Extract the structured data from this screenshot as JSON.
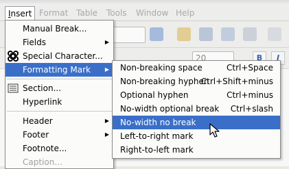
{
  "menubar": {
    "items": [
      {
        "label": "Insert",
        "accel": "I",
        "rest": "nsert"
      },
      {
        "label": "Format"
      },
      {
        "label": "Table"
      },
      {
        "label": "Tools"
      },
      {
        "label": "Window"
      },
      {
        "label": "Help"
      }
    ]
  },
  "format_bar": {
    "font_size": "20"
  },
  "insert_menu": {
    "items": [
      {
        "label": "Manual Break...",
        "a": "",
        "u": "",
        "b": "Manual ",
        "u2": "B",
        "c": "reak..."
      },
      {
        "label": "Fields"
      },
      {
        "label": "Special Character..."
      },
      {
        "label": "Formatting Mark"
      },
      {
        "label": "Section..."
      },
      {
        "label": "Hyperlink"
      },
      {
        "label": "Header"
      },
      {
        "label": "Footer"
      },
      {
        "label": "Footnote..."
      },
      {
        "label": "Caption..."
      }
    ]
  },
  "formatting_submenu": {
    "items": [
      {
        "label": "Non-breaking space",
        "shortcut": "Ctrl+Space"
      },
      {
        "label": "Non-breaking hyphen",
        "shortcut": "Ctrl+Shift+minus"
      },
      {
        "label": "Optional hyphen",
        "shortcut": "Ctrl+minus"
      },
      {
        "label": "No-width optional break",
        "shortcut": "Ctrl+slash"
      },
      {
        "label": "No-width no break",
        "shortcut": ""
      },
      {
        "label": "Left-to-right mark",
        "shortcut": ""
      },
      {
        "label": "Right-to-left mark",
        "shortcut": ""
      }
    ]
  },
  "colors": {
    "highlight": "#3a6fc9",
    "disabled": "#a0a0a0"
  }
}
